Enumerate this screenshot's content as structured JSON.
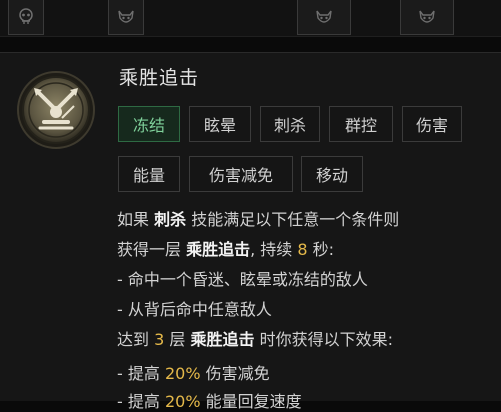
{
  "skill": {
    "name": "乘胜追击",
    "tags": [
      "冻结",
      "眩晕",
      "刺杀",
      "群控",
      "伤害",
      "能量",
      "伤害减免",
      "移动"
    ],
    "selected_tag": "冻结"
  },
  "description": {
    "line1": {
      "a": "如果 ",
      "kw": "刺杀",
      "b": " 技能满足以下任意一个条件则"
    },
    "line2": {
      "a": "获得一层 ",
      "kw": "乘胜追击",
      "b": ", 持续 ",
      "num": "8",
      "c": " 秒:"
    },
    "line3": "- 命中一个昏迷、眩晕或冻结的敌人",
    "line4": "- 从背后命中任意敌人",
    "line5": {
      "a": "达到 ",
      "num": "3",
      "b": " 层 ",
      "kw": "乘胜追击",
      "c": " 时你获得以下效果:"
    },
    "line6": {
      "a": "- 提高 ",
      "num": "20%",
      "b": " 伤害减免"
    },
    "line7": {
      "a": "- 提高 ",
      "num": "20%",
      "b": " 能量回复速度"
    }
  },
  "icons": {
    "emblem": "crossed-daggers-emblem-icon",
    "top_slots": [
      "skull-icon",
      "demon-face-icon",
      "demon-face-icon",
      "demon-face-icon"
    ]
  },
  "colors": {
    "accent_green": "#7fd09a",
    "value_gold": "#e5b94a",
    "keyword_white": "#f3f3f3"
  }
}
